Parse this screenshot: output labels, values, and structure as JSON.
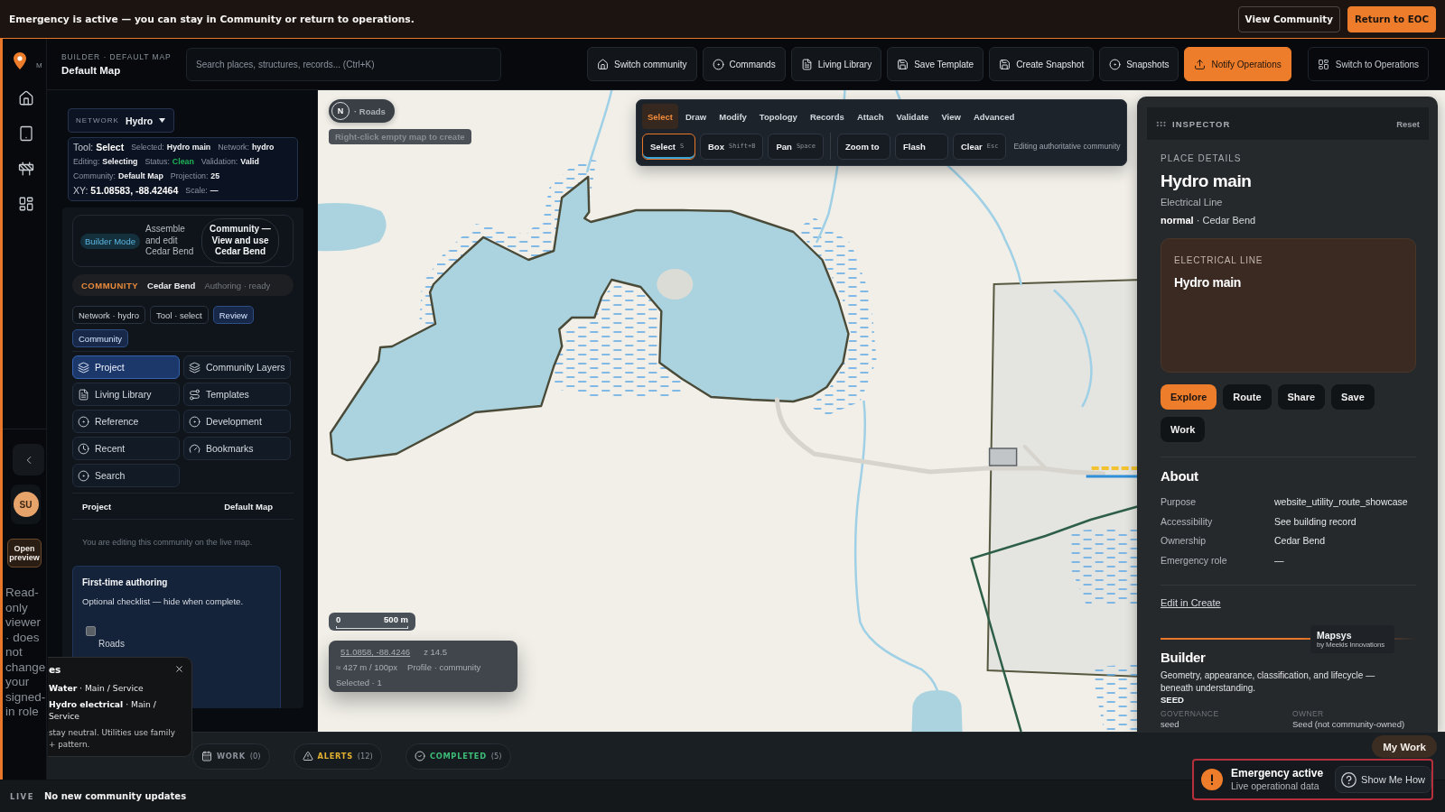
{
  "banner": {
    "message": "Emergency is active — you can stay in Community or return to operations.",
    "buttons": [
      {
        "label": "View Community",
        "kind": "secondary"
      },
      {
        "label": "Return to EOC",
        "kind": "primary"
      }
    ]
  },
  "rail": {
    "brand_text": "M",
    "avatar_initials": "SU",
    "preview_button": "Open preview",
    "role_note": "Read-only viewer · does not change your signed-in role"
  },
  "header": {
    "breadcrumb": "BUILDER · DEFAULT MAP",
    "title": "Default Map",
    "search": {
      "placeholder": "Search places, structures, records... (Ctrl+K)"
    },
    "actions": [
      {
        "label": "Switch community",
        "kind": "default"
      },
      {
        "label": "Commands",
        "kind": "default"
      },
      {
        "label": "Living Library",
        "kind": "default"
      },
      {
        "label": "Save Template",
        "kind": "default"
      },
      {
        "label": "Create Snapshot",
        "kind": "default"
      },
      {
        "label": "Snapshots",
        "kind": "default"
      },
      {
        "label": "Notify Operations",
        "kind": "primary"
      }
    ],
    "switch_button": "Switch to Operations"
  },
  "left_panel": {
    "network": {
      "label": "NETWORK",
      "value": "Hydro"
    },
    "status_lines": [
      [
        {
          "label": "Tool:",
          "value": "Select",
          "kind": "large"
        },
        {
          "label": "Selected:",
          "value": "Hydro main",
          "kind": "plain"
        },
        {
          "label": "Network:",
          "value": "hydro",
          "kind": "plain"
        }
      ],
      [
        {
          "label": "Editing:",
          "value": "Selecting",
          "kind": "plain"
        },
        {
          "label": "Status:",
          "value": "Clean",
          "kind": "ok"
        },
        {
          "label": "Validation:",
          "value": "Valid",
          "kind": "plain"
        }
      ],
      [
        {
          "label": "Community:",
          "value": "Default Map",
          "kind": "plain"
        },
        {
          "label": "Projection:",
          "value": "25",
          "kind": "plain"
        }
      ],
      [
        {
          "label": "XY:",
          "value": "51.08583, -88.42464",
          "kind": "large"
        },
        {
          "label": "Scale:",
          "value": "—",
          "kind": "plain"
        }
      ]
    ],
    "mode_card": {
      "badge": "Builder Mode",
      "description": "Assemble and edit Cedar Bend",
      "switch_button": "Community — View and use Cedar Bend"
    },
    "community": {
      "label": "COMMUNITY",
      "name": "Cedar Bend",
      "status": "Authoring · ready"
    },
    "chips": [
      {
        "label": "Network · hydro",
        "selected": false
      },
      {
        "label": "Tool · select",
        "selected": false
      },
      {
        "label": "Review",
        "selected": true
      },
      {
        "label": "Community",
        "selected": true
      }
    ],
    "nav": [
      {
        "label": "Project",
        "selected": true
      },
      {
        "label": "Community Layers",
        "selected": false
      },
      {
        "label": "Living Library",
        "selected": false
      },
      {
        "label": "Templates",
        "selected": false
      },
      {
        "label": "Reference",
        "selected": false
      },
      {
        "label": "Development",
        "selected": false
      },
      {
        "label": "Recent",
        "selected": false
      },
      {
        "label": "Bookmarks",
        "selected": false
      },
      {
        "label": "Search",
        "selected": false
      }
    ],
    "project_row": {
      "label": "Project",
      "value": "Default Map"
    },
    "note": "You are editing this community on the live map.",
    "onboarding": {
      "title": "First-time authoring",
      "subtitle": "Optional checklist — hide when complete.",
      "items": [
        {
          "label": "Roads",
          "checked": false
        }
      ]
    }
  },
  "legend_popup": {
    "title": "es",
    "entries": [
      "**Water** · Main / Service",
      "**Hydro electrical** · Main / Service"
    ],
    "note": "stay neutral. Utilities use family + pattern."
  },
  "map": {
    "compass": {
      "letter": "N",
      "layer": "· Roads"
    },
    "hint": "Right-click empty map to create",
    "edit_toolbar": {
      "tabs": [
        {
          "label": "Select",
          "selected": true
        },
        {
          "label": "Draw",
          "selected": false
        },
        {
          "label": "Modify",
          "selected": false
        },
        {
          "label": "Topology",
          "selected": false
        },
        {
          "label": "Records",
          "selected": false
        },
        {
          "label": "Attach",
          "selected": false
        },
        {
          "label": "Validate",
          "selected": false
        },
        {
          "label": "View",
          "selected": false
        },
        {
          "label": "Advanced",
          "selected": false
        }
      ],
      "tool_groups": [
        [
          {
            "label": "Select",
            "shortcut": "S",
            "selected": true
          },
          {
            "label": "Box",
            "shortcut": "Shift+B",
            "selected": false
          },
          {
            "label": "Pan",
            "shortcut": "Space",
            "selected": false
          }
        ],
        [
          {
            "label": "Zoom to",
            "selected": false
          },
          {
            "label": "Flash",
            "selected": false
          },
          {
            "label": "Clear",
            "shortcut": "Esc",
            "selected": false
          }
        ]
      ],
      "note": "Editing authoritative community"
    },
    "scale": {
      "start": "0",
      "end": "500 m"
    },
    "readout": {
      "coords": "51.0858, -88.4246",
      "zoom": "z 14.5",
      "resolution": "≈ 427 m / 100px",
      "profile": "Profile · community",
      "selection": "Selected · 1"
    },
    "attribution": {
      "name": "Mapsys",
      "byline": "by Meekis Innovations"
    }
  },
  "inspector": {
    "title": "INSPECTOR",
    "reset": "Reset",
    "eyebrow": "PLACE DETAILS",
    "name": "Hydro main",
    "type": "Electrical Line",
    "meta": "**normal** · Cedar Bend",
    "preview": {
      "eyebrow": "ELECTRICAL LINE",
      "name": "Hydro main"
    },
    "actions": [
      {
        "label": "Explore",
        "kind": "primary"
      },
      {
        "label": "Route",
        "kind": "default"
      },
      {
        "label": "Share",
        "kind": "default"
      },
      {
        "label": "Save",
        "kind": "default"
      },
      {
        "label": "Work",
        "kind": "default"
      }
    ],
    "about": {
      "heading": "About",
      "rows": [
        {
          "label": "Purpose",
          "value": "website_utility_route_showcase"
        },
        {
          "label": "Accessibility",
          "value": "See building record"
        },
        {
          "label": "Ownership",
          "value": "Cedar Bend"
        },
        {
          "label": "Emergency role",
          "value": "—"
        }
      ]
    },
    "edit_link": "Edit in Create",
    "builder": {
      "heading": "Builder",
      "description": "Geometry, appearance, classification, and lifecycle — beneath understanding.",
      "tag": "SEED",
      "fields": [
        {
          "label": "GOVERNANCE",
          "value": "seed"
        },
        {
          "label": "OWNER",
          "value": "Seed (not community-owned)"
        }
      ]
    }
  },
  "bottom_tabs": [
    {
      "label": "WORK",
      "count": "(0)",
      "color": "#8b9199"
    },
    {
      "label": "ALERTS",
      "count": "(12)",
      "color": "#e2b12f"
    },
    {
      "label": "COMPLETED",
      "count": "(5)",
      "color": "#3dbd78"
    }
  ],
  "my_work_button": "My Work",
  "toast": {
    "title": "Emergency active",
    "subtitle": "Live operational data",
    "help_button": "Show Me How"
  },
  "status_bar": {
    "label": "LIVE",
    "message": "No new community updates"
  }
}
